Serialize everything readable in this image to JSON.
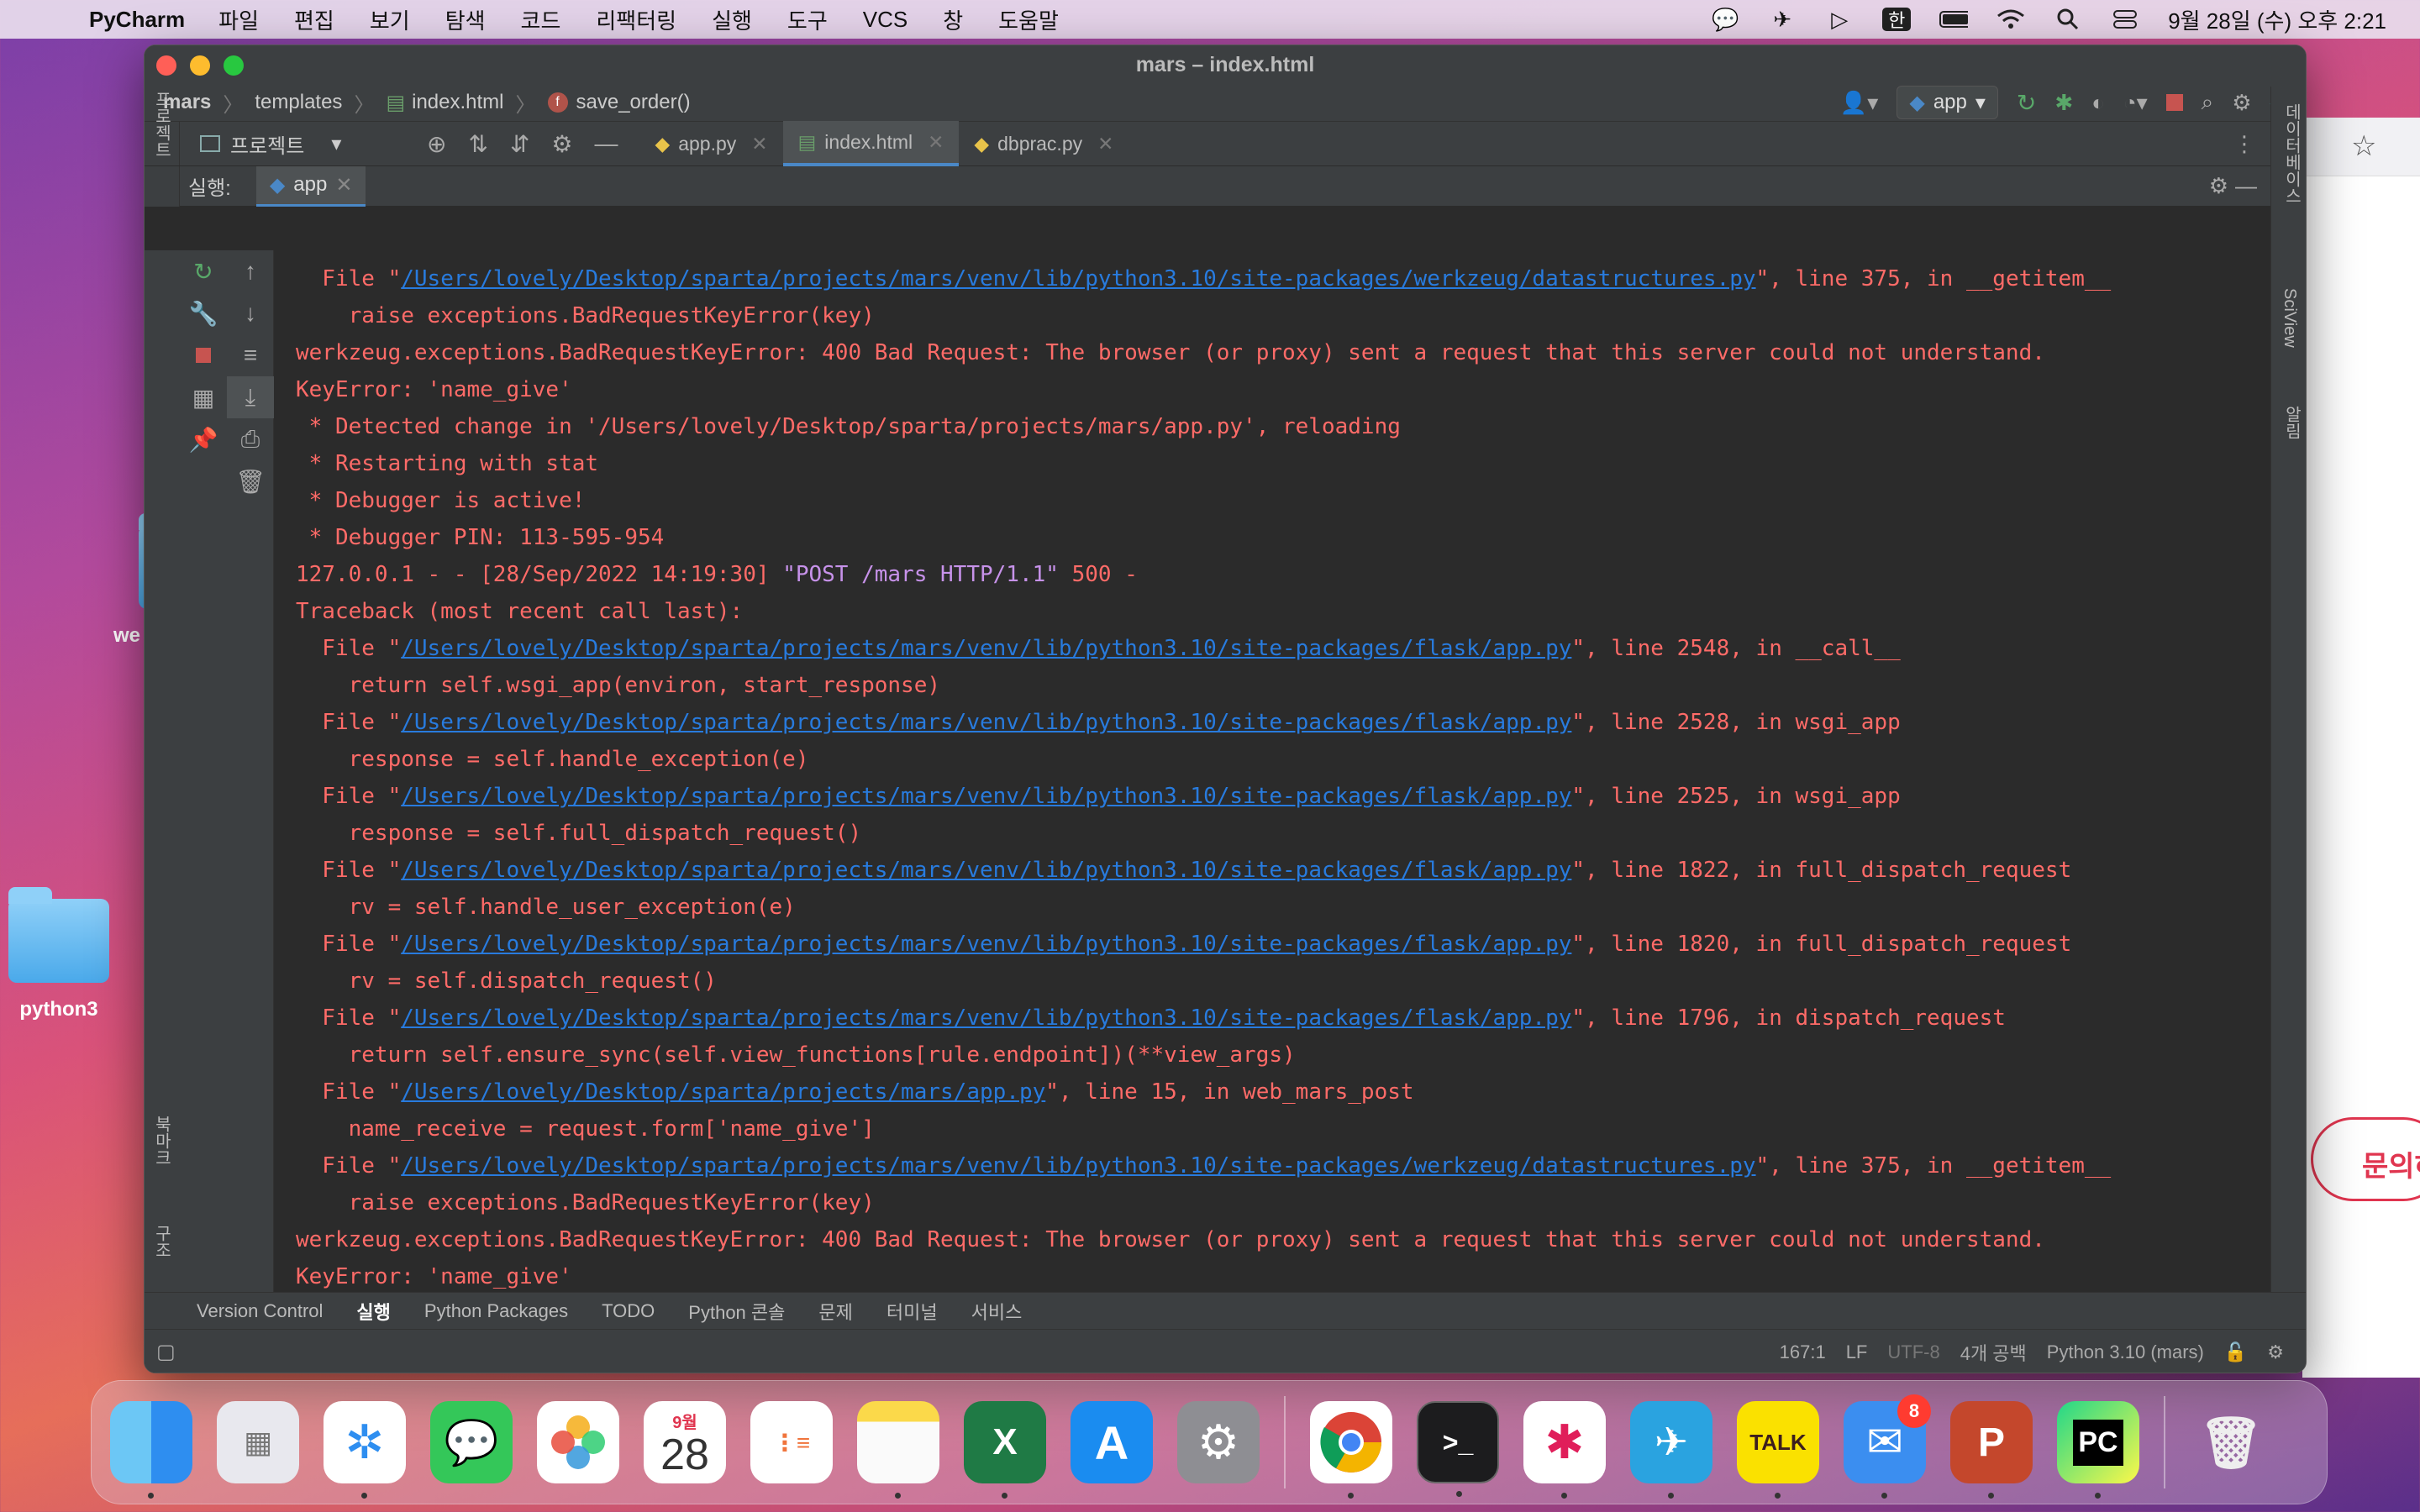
{
  "menubar": {
    "app_name": "PyCharm",
    "menus": [
      "파일",
      "편집",
      "보기",
      "탐색",
      "코드",
      "리팩터링",
      "실행",
      "도구",
      "VCS",
      "창",
      "도움말"
    ],
    "input_source": "한",
    "datetime": "9월 28일 (수) 오후 2:21"
  },
  "desktop": {
    "folder_partial_label": "we",
    "folder_label": "python3",
    "browser_button": "문의하"
  },
  "window": {
    "title": "mars – index.html",
    "breadcrumb": [
      "mars",
      "templates",
      "index.html",
      "save_order()"
    ],
    "run_config": "app",
    "project_label": "프로젝트",
    "tabs": [
      {
        "label": "app.py"
      },
      {
        "label": "index.html"
      },
      {
        "label": "dbprac.py"
      }
    ],
    "run_label": "실행:",
    "run_tab": "app"
  },
  "side_labels": {
    "left_top": "프로젝트",
    "left_bottom1": "북마크",
    "left_bottom2": "구조",
    "right_top": "데이터베이스",
    "right_mid": "SciView",
    "right_bot": "알림"
  },
  "console_lines": [
    {
      "pre": "  File \"",
      "link": "/Users/lovely/Desktop/sparta/projects/mars/venv/lib/python3.10/site-packages/werkzeug/datastructures.py",
      "post": "\", line 375, in __getitem__"
    },
    {
      "pre": "    raise exceptions.BadRequestKeyError(key)"
    },
    {
      "pre": "werkzeug.exceptions.BadRequestKeyError: 400 Bad Request: The browser (or proxy) sent a request that this server could not understand."
    },
    {
      "pre": "KeyError: 'name_give'"
    },
    {
      "pre": " * Detected change in '/Users/lovely/Desktop/sparta/projects/mars/app.py', reloading"
    },
    {
      "pre": " * Restarting with stat"
    },
    {
      "pre": " * Debugger is active!"
    },
    {
      "pre": " * Debugger PIN: 113-595-954"
    },
    {
      "pre": "127.0.0.1 - - [28/Sep/2022 14:19:30] ",
      "hl": "\"POST /mars HTTP/1.1\"",
      "post": " 500 -"
    },
    {
      "pre": "Traceback (most recent call last):"
    },
    {
      "pre": "  File \"",
      "link": "/Users/lovely/Desktop/sparta/projects/mars/venv/lib/python3.10/site-packages/flask/app.py",
      "post": "\", line 2548, in __call__"
    },
    {
      "pre": "    return self.wsgi_app(environ, start_response)"
    },
    {
      "pre": "  File \"",
      "link": "/Users/lovely/Desktop/sparta/projects/mars/venv/lib/python3.10/site-packages/flask/app.py",
      "post": "\", line 2528, in wsgi_app"
    },
    {
      "pre": "    response = self.handle_exception(e)"
    },
    {
      "pre": "  File \"",
      "link": "/Users/lovely/Desktop/sparta/projects/mars/venv/lib/python3.10/site-packages/flask/app.py",
      "post": "\", line 2525, in wsgi_app"
    },
    {
      "pre": "    response = self.full_dispatch_request()"
    },
    {
      "pre": "  File \"",
      "link": "/Users/lovely/Desktop/sparta/projects/mars/venv/lib/python3.10/site-packages/flask/app.py",
      "post": "\", line 1822, in full_dispatch_request"
    },
    {
      "pre": "    rv = self.handle_user_exception(e)"
    },
    {
      "pre": "  File \"",
      "link": "/Users/lovely/Desktop/sparta/projects/mars/venv/lib/python3.10/site-packages/flask/app.py",
      "post": "\", line 1820, in full_dispatch_request"
    },
    {
      "pre": "    rv = self.dispatch_request()"
    },
    {
      "pre": "  File \"",
      "link": "/Users/lovely/Desktop/sparta/projects/mars/venv/lib/python3.10/site-packages/flask/app.py",
      "post": "\", line 1796, in dispatch_request"
    },
    {
      "pre": "    return self.ensure_sync(self.view_functions[rule.endpoint])(**view_args)"
    },
    {
      "pre": "  File \"",
      "link": "/Users/lovely/Desktop/sparta/projects/mars/app.py",
      "post": "\", line 15, in web_mars_post"
    },
    {
      "pre": "    name_receive = request.form['name_give']"
    },
    {
      "pre": "  File \"",
      "link": "/Users/lovely/Desktop/sparta/projects/mars/venv/lib/python3.10/site-packages/werkzeug/datastructures.py",
      "post": "\", line 375, in __getitem__"
    },
    {
      "pre": "    raise exceptions.BadRequestKeyError(key)"
    },
    {
      "pre": "werkzeug.exceptions.BadRequestKeyError: 400 Bad Request: The browser (or proxy) sent a request that this server could not understand."
    },
    {
      "pre": "KeyError: 'name_give'"
    }
  ],
  "bottom_tabs": [
    "Version Control",
    "실행",
    "Python Packages",
    "TODO",
    "Python 콘솔",
    "문제",
    "터미널",
    "서비스"
  ],
  "status": {
    "position": "167:1",
    "line_sep": "LF",
    "encoding": "UTF-8",
    "indent": "4개 공백",
    "interpreter": "Python 3.10 (mars)"
  },
  "dock": {
    "calendar_month": "9월",
    "calendar_day": "28",
    "mail_badge": "8",
    "kakao_label": "TALK",
    "pycharm_label": "PC"
  },
  "colors": {
    "console_error": "#ff6b68",
    "link": "#287bde",
    "ide_bg": "#2b2b2b",
    "panel": "#3c3f41"
  }
}
